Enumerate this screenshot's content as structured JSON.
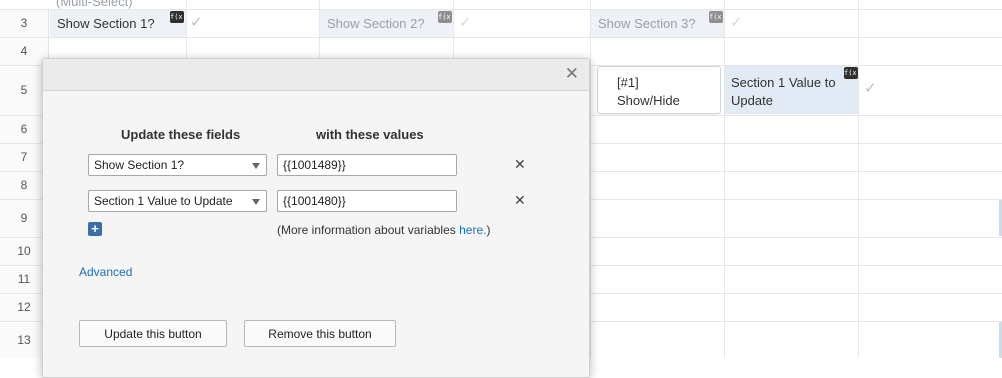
{
  "sheet": {
    "rows": [
      "3",
      "4",
      "5",
      "6",
      "7",
      "8",
      "9",
      "10",
      "11",
      "12",
      "13"
    ],
    "top_fragment": "(Multi-Select)",
    "row3": {
      "label1": "Show Section 1?",
      "label2": "Show Section 2?",
      "label3": "Show Section 3?"
    },
    "row5": {
      "button_label_line1": "[#1]",
      "button_label_line2": "Show/Hide",
      "value_line1": "Section 1 Value to",
      "value_line2": "Update"
    },
    "fx_badge": "f(x)",
    "check_mark": "✓"
  },
  "modal": {
    "close": "✕",
    "col_fields": "Update these fields",
    "col_values": "with these values",
    "rows": [
      {
        "field": "Show Section 1?",
        "value": "{{1001489}}",
        "remove": "✕"
      },
      {
        "field": "Section 1 Value to Update",
        "value": "{{1001480}}",
        "remove": "✕"
      }
    ],
    "add": "+",
    "info_prefix": "(More information about variables ",
    "info_link": "here.",
    "info_suffix": ")",
    "advanced": "Advanced",
    "update_btn": "Update this button",
    "remove_btn": "Remove this button"
  },
  "colors": {
    "link": "#1a6fbf",
    "add_button": "#3a6fa8",
    "label_cell": "#eef1f6",
    "value_cell": "#e2eaf5"
  }
}
